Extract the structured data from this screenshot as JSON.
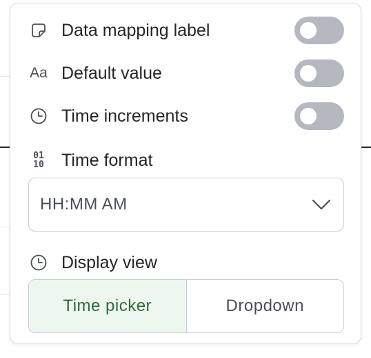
{
  "settings": {
    "data_mapping_label": {
      "label": "Data mapping label",
      "icon": "tag-icon",
      "enabled": false
    },
    "default_value": {
      "label": "Default value",
      "icon": "text-aa-icon",
      "icon_text": "Aa",
      "enabled": false
    },
    "time_increments": {
      "label": "Time increments",
      "icon": "clock-icon",
      "enabled": false
    }
  },
  "time_format": {
    "label": "Time format",
    "icon": "binary-icon",
    "icon_text_top": "01",
    "icon_text_bottom": "10",
    "selected": "HH:MM AM"
  },
  "display_view": {
    "label": "Display view",
    "icon": "clock-icon",
    "options": [
      "Time picker",
      "Dropdown"
    ],
    "selected": "Time picker"
  },
  "colors": {
    "toggle_off": "#b5b9bf",
    "active_segment_bg": "#eef7ef",
    "active_segment_text": "#2f6b3c",
    "text": "#22252a"
  }
}
